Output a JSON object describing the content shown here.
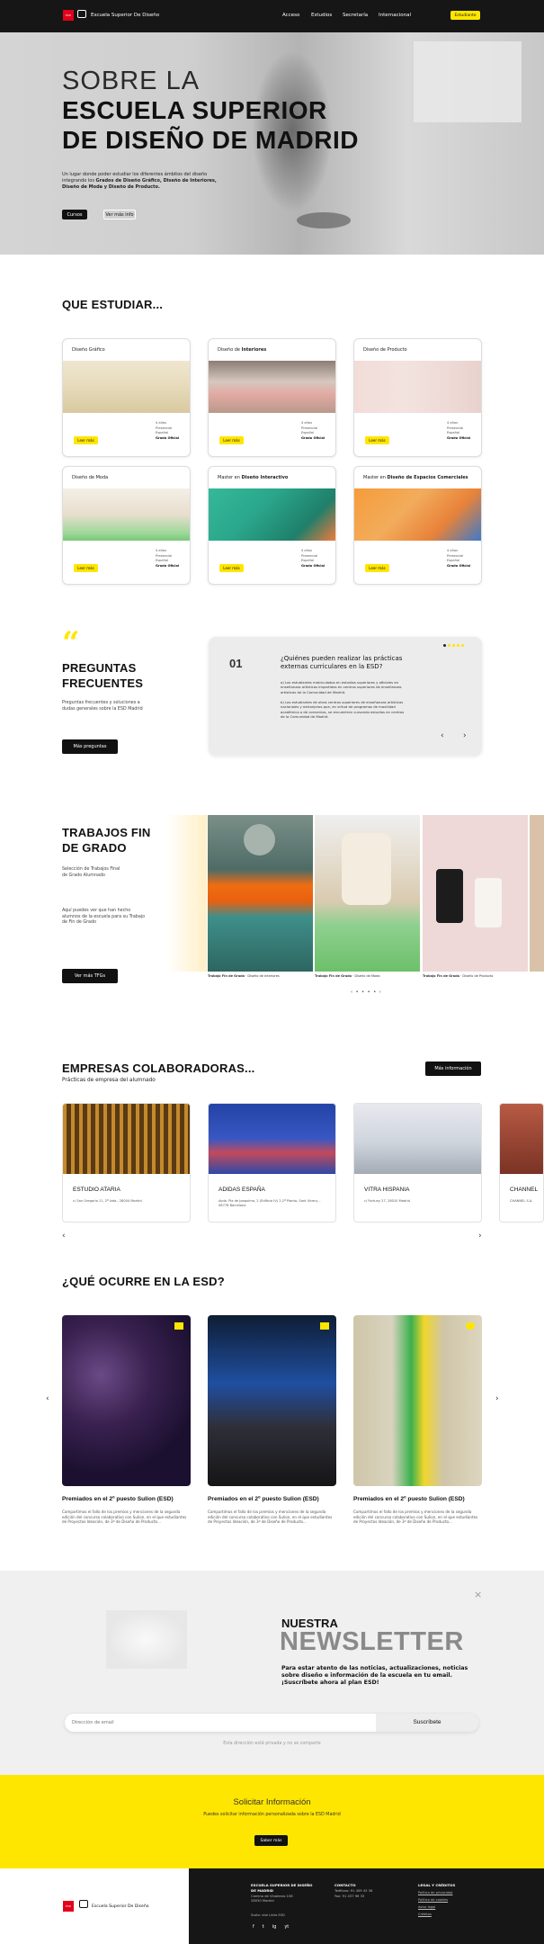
{
  "header": {
    "brand": "Escuela Superior De Diseño",
    "logo_text": "ESD",
    "nav": [
      "Acceso",
      "Estudios",
      "Secretaría",
      "Internacional"
    ],
    "cta": "Estudiante"
  },
  "hero": {
    "title_line1": "SOBRE LA",
    "title_line2": "ESCUELA SUPERIOR",
    "title_line3": "DE DISEÑO DE MADRID",
    "text_intro": "Un lugar donde poder estudiar los diferentes ámbitos del diseño integrando los ",
    "text_bold": "Grados de Diseño Gráfico, Diseño de Interiores, Diseño de Moda y Diseño de Producto.",
    "btn_primary": "Cursos",
    "btn_secondary": "Ver más info"
  },
  "studies": {
    "heading": "QUE ESTUDIAR...",
    "meta": [
      "4 años",
      "Presencial",
      "Español",
      "Grado Oficial"
    ],
    "button": "Leer más",
    "cards": [
      {
        "title": "Diseño Gráfico",
        "title_bold": ""
      },
      {
        "title": "Diseño de ",
        "title_bold": "Interiores"
      },
      {
        "title": "Diseño de Producto",
        "title_bold": ""
      },
      {
        "title": "Diseño de Moda",
        "title_bold": ""
      },
      {
        "title": "Master en ",
        "title_bold": "Diseño Interactivo"
      },
      {
        "title": "Master en ",
        "title_bold": "Diseño de Espacios Comerciales"
      }
    ]
  },
  "faq": {
    "heading_line1": "PREGUNTAS",
    "heading_line2": "FRECUENTES",
    "text": "Preguntas frecuentes y soluciones a dudas generales sobre la ESD Madrid",
    "button": "Más preguntas",
    "number": "01",
    "question": "¿Quiénes pueden realizar las prácticas externas curriculares en la ESD?",
    "answer_p1": "a) Los estudiantes matriculados en estudios superiores y oficiales en enseñanzas artísticas impartidas en centros superiores de enseñanzas artísticas de la Comunidad de Madrid.",
    "answer_p2": "b) Los estudiantes de otros centros superiores de enseñanzas artísticas nacionales y extranjeros que, en virtud de programas de movilidad académica o de convenios, se encuentren cursando estudios en centros de la Comunidad de Madrid."
  },
  "tfg": {
    "heading_line1": "TRABAJOS FIN",
    "heading_line2": "DE GRADO",
    "subtitle": "Selección de Trabajos Final de Grado Alumnado",
    "text": "Aquí puedes ver que han hecho alumnos de la escuela para su Trabajo de Fin de Grado",
    "button": "Ver más TFGs",
    "captions": [
      {
        "bold": "Trabajo Fin de Grado",
        "rest": " · Diseño de Interiores"
      },
      {
        "bold": "Trabajo Fin de Grado",
        "rest": " · Diseño de Moda"
      },
      {
        "bold": "Trabajo Fin de Grado",
        "rest": " · Diseño de Producto"
      }
    ],
    "pager": "‹ • • • • ›"
  },
  "companies": {
    "heading": "EMPRESAS COLABORADORAS...",
    "subtitle": "Prácticas de empresa del alumnado",
    "button": "Más información",
    "items": [
      {
        "name": "ESTUDIO ATARIA",
        "address": "c/ San Gregorio 11, 2º Izda., 28004 Madrid"
      },
      {
        "name": "ADIDAS ESPAÑA",
        "address": "Avda. Pla de Joaquima, 2 (Edificio IV) 2,1ª Planta, Sant Vicenç – 08778 Barcelona"
      },
      {
        "name": "VITRA HISPANIA",
        "address": "c/ Fortuny 27, 28010 Madrid"
      },
      {
        "name": "CHANNEL",
        "address": "CHANNEL S.A."
      }
    ]
  },
  "news": {
    "heading": "¿QUÉ OCURRE EN LA ESD?",
    "items": [
      {
        "title": "Premiados en el 2º puesto Sulion (ESD)",
        "text": "Compartimos el fallo de los premios y menciones de la segunda edición del concurso colaborativo con Sulion, en el que estudiantes de Proyectos Ideación, de 3º de Diseño de Producto..."
      },
      {
        "title": "Premiados en el 2º puesto Sulion (ESD)",
        "text": "Compartimos el fallo de los premios y menciones de la segunda edición del concurso colaborativo con Sulion, en el que estudiantes de Proyectos Ideación, de 3º de Diseño de Producto..."
      },
      {
        "title": "Premiados en el 2º puesto Sulion (ESD)",
        "text": "Compartimos el fallo de los premios y menciones de la segunda edición del concurso colaborativo con Sulion, en el que estudiantes de Proyectos Ideación, de 3º de Diseño de Producto..."
      }
    ]
  },
  "newsletter": {
    "heading_line1": "NUESTRA",
    "heading_line2": "NEWSLETTER",
    "text": "Para estar atento de las noticias, actualizaciones, noticias sobre diseño e información de la escuela en tu email. ¡Suscríbete ahora al plan ESD!",
    "placeholder": "Dirección de email",
    "button": "Suscríbete",
    "privacy": "Esta dirección está privada y no se comparte"
  },
  "request": {
    "title": "Solicitar Información",
    "text": "Puedes solicitar información personalizada sobre la ESD Madrid",
    "button": "Saber más"
  },
  "footer": {
    "brand": "Escuela Superior De Diseño",
    "address_title": "ESCUELA SUPERIOR DE DISEÑO DE MADRID",
    "address": "Camino de Vinateros 106 28030 Madrid",
    "address_extra": "Scoto: vise Linke ESD",
    "contact_title": "CONTACTO",
    "contact_lines": [
      "Teléfono: 91 409 43 36",
      "Fax: 91 437 96 33"
    ],
    "legal_title": "LEGAL Y CRÉDITOS",
    "legal_links": [
      "Política de privacidad",
      "Política de cookies",
      "Aviso legal",
      "Créditos"
    ],
    "social": [
      "f",
      "t",
      "ig",
      "yt"
    ]
  },
  "colors": {
    "accent": "#ffe600",
    "dark": "#111111"
  }
}
